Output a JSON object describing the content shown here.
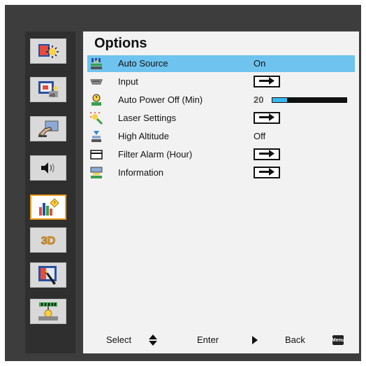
{
  "menu": {
    "title": "Options",
    "sidebar": [
      {
        "icon": "image-settings-icon"
      },
      {
        "icon": "screen-display-icon"
      },
      {
        "icon": "setup-hand-icon"
      },
      {
        "icon": "volume-icon"
      },
      {
        "icon": "options-bars-icon"
      },
      {
        "icon": "3d-icon",
        "text": "3D"
      },
      {
        "icon": "interactive-pen-icon"
      },
      {
        "icon": "lan-network-icon"
      }
    ],
    "items": [
      {
        "label": "Auto Source",
        "value": "On",
        "icon": "auto-source-icon",
        "kind": "value"
      },
      {
        "label": "Input",
        "icon": "input-port-icon",
        "kind": "arrow"
      },
      {
        "label": "Auto Power Off (Min)",
        "value": "20",
        "level": 0.2,
        "icon": "power-timer-icon",
        "kind": "slider"
      },
      {
        "label": "Laser Settings",
        "icon": "laser-icon",
        "kind": "arrow"
      },
      {
        "label": "High Altitude",
        "value": "Off",
        "icon": "high-altitude-icon",
        "kind": "value"
      },
      {
        "label": "Filter Alarm (Hour)",
        "icon": "filter-icon",
        "kind": "arrow"
      },
      {
        "label": "Information",
        "icon": "information-icon",
        "kind": "arrow"
      }
    ],
    "selected_index": 0
  },
  "footer": {
    "select_label": "Select",
    "enter_label": "Enter",
    "back_label": "Back",
    "menu_key_label": "Menu"
  },
  "colors": {
    "highlight": "#6ec3ef",
    "slider_fill": "#3ab8ee",
    "active_border": "#f0a020"
  }
}
